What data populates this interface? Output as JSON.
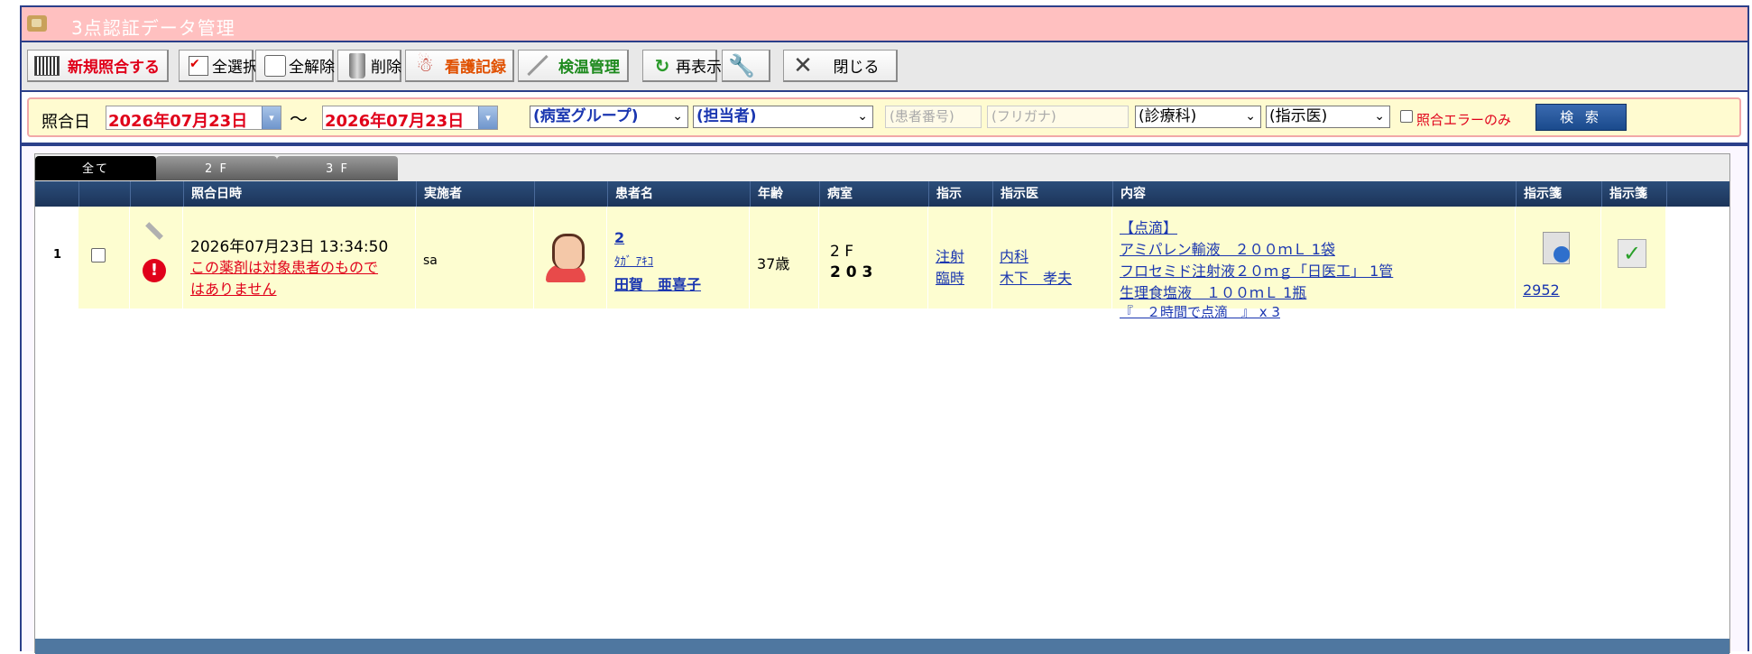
{
  "window": {
    "title": "3点認証データ管理"
  },
  "toolbar": {
    "new_match": "新規照合する",
    "select_all": "全選択",
    "deselect_all": "全解除",
    "delete": "削除",
    "nursing_record": "看護記録",
    "temperature": "検温管理",
    "refresh": "再表示",
    "close": "閉じる",
    "check_mark": "✔",
    "colors": {
      "new_match": "#e0001a",
      "nursing_record": "#e05000",
      "temperature": "#1e8a1e"
    }
  },
  "search": {
    "date_label": "照合日",
    "date_from": "2026年07月23日",
    "date_to": "2026年07月23日",
    "tilde": "〜",
    "ward_group": "(病室グループ)",
    "staff": "(担当者)",
    "patient_no_placeholder": "(患者番号)",
    "furigana_placeholder": "(フリガナ)",
    "department": "(診療科)",
    "doctor": "(指示医)",
    "error_only": "照合エラーのみ",
    "search_button": "検 索"
  },
  "tabs": [
    "全て",
    "2 F",
    "3 F"
  ],
  "columns": [
    "照合日時",
    "実施者",
    "患者名",
    "年齢",
    "病室",
    "指示",
    "指示医",
    "内容",
    "指示箋",
    "指示箋"
  ],
  "rows": [
    {
      "index": "1",
      "datetime": "2026年07月23日 13:34:50",
      "error_line1": "この薬剤は対象患者のもので",
      "error_line2": "はありません",
      "operator": "sa",
      "patient_id": "2",
      "patient_kana": "ﾀｶﾞ ｱｷｺ",
      "patient_name": "田賀　亜喜子",
      "age": "37歳",
      "floor": "2 F",
      "room": "2 0 3",
      "order_type": "注射",
      "order_kind": "臨時",
      "department": "内科",
      "doctor": "木下　孝夫",
      "content": [
        "【点滴】",
        "アミパレン輸液　２００ｍＬ 1袋",
        "フロセミド注射液２０ｍｇ「日医工」 1管",
        "生理食塩液　１００ｍＬ 1瓶",
        "『　２時間で点滴　』 x 3"
      ],
      "order_slip_no": "2952",
      "alert_mark": "!"
    }
  ]
}
